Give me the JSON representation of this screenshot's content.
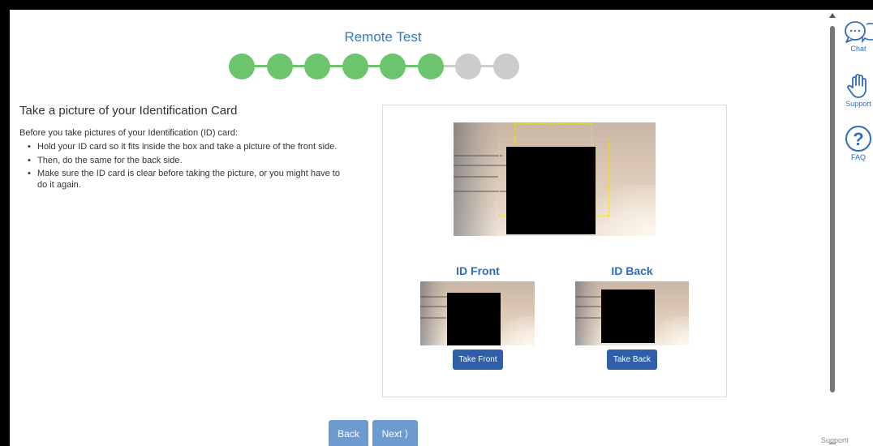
{
  "page": {
    "title": "Remote Test"
  },
  "stepper": {
    "total_steps": 8,
    "completed_steps": 6,
    "colors": {
      "complete": "#6cc56c",
      "incomplete": "#cccccc"
    }
  },
  "instructions": {
    "heading": "Take a picture of your Identification Card",
    "intro": "Before you take pictures of your Identification (ID) card:",
    "bullets": [
      "Hold your ID card so it fits inside the box and take a picture of the front side.",
      "Then, do the same for the back side.",
      "Make sure the ID card is clear before taking the picture, or you might have to do it again."
    ]
  },
  "capture": {
    "front_label": "ID Front",
    "back_label": "ID Back",
    "take_front": "Take Front",
    "take_back": "Take Back"
  },
  "nav": {
    "back": "Back",
    "next": "Next ⟩"
  },
  "side_tools": [
    {
      "label": "Chat",
      "icon": "chat-icon"
    },
    {
      "label": "Support",
      "icon": "hand-icon"
    },
    {
      "label": "FAQ",
      "icon": "help-icon"
    }
  ],
  "footer": {
    "support_text": "SupportI"
  },
  "colors": {
    "accent": "#3a78b5",
    "button": "#2e5fa8",
    "nav_button": "#6d9bd0",
    "guide": "#f2e100"
  }
}
